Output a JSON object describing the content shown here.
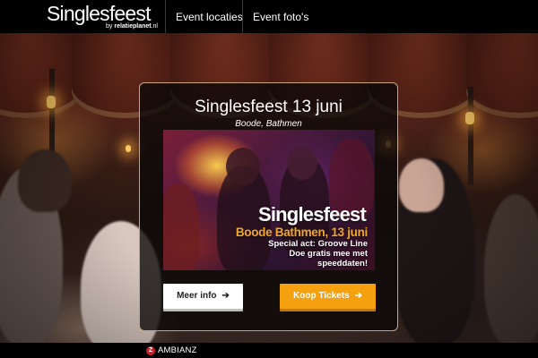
{
  "header": {
    "logo": "Singlesfeest",
    "logo_sub_prefix": "by ",
    "logo_sub_brand": "relatieplanet",
    "logo_sub_suffix": ".nl",
    "nav": [
      {
        "label": "Event locaties"
      },
      {
        "label": "Event foto's"
      }
    ]
  },
  "modal": {
    "title": "Singlesfeest 13 juni",
    "subtitle": "Boode, Bathmen",
    "poster": {
      "title": "Singlesfeest",
      "line1": "Boode Bathmen, 13 juni",
      "line2": "Special act: Groove Line",
      "line3": "Doe gratis mee met",
      "line4": "speeddaten!"
    },
    "buttons": {
      "info_label": "Meer info",
      "tickets_label": "Koop Tickets",
      "arrow": "➔"
    }
  },
  "footer": {
    "brand": "AMBIANZ",
    "brand_mark": "Z"
  },
  "colors": {
    "accent": "#f5a00f",
    "border": "#c9a67a",
    "footer_mark": "#d41f26"
  }
}
